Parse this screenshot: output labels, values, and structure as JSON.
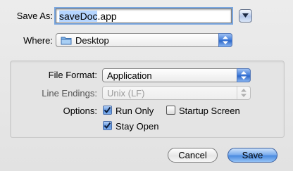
{
  "save_as": {
    "label": "Save As:",
    "filename_selected": "saveDoc",
    "filename_rest": ".app"
  },
  "where": {
    "label": "Where:",
    "value": "Desktop"
  },
  "options_box": {
    "file_format_label": "File Format:",
    "file_format_value": "Application",
    "line_endings_label": "Line Endings:",
    "line_endings_value": "Unix (LF)",
    "options_label": "Options:",
    "run_only_label": "Run Only",
    "run_only_checked": true,
    "startup_screen_label": "Startup Screen",
    "startup_screen_checked": false,
    "stay_open_label": "Stay Open",
    "stay_open_checked": true
  },
  "buttons": {
    "cancel": "Cancel",
    "save": "Save"
  },
  "colors": {
    "accent": "#3f7ad9",
    "selection": "#b5d5ff",
    "focus_ring": "#79a6df"
  },
  "icons": {
    "disclosure": "triangle-down-icon",
    "folder": "folder-icon",
    "popup_arrows": "up-down-arrows-icon",
    "checkmark": "checkmark-icon"
  }
}
